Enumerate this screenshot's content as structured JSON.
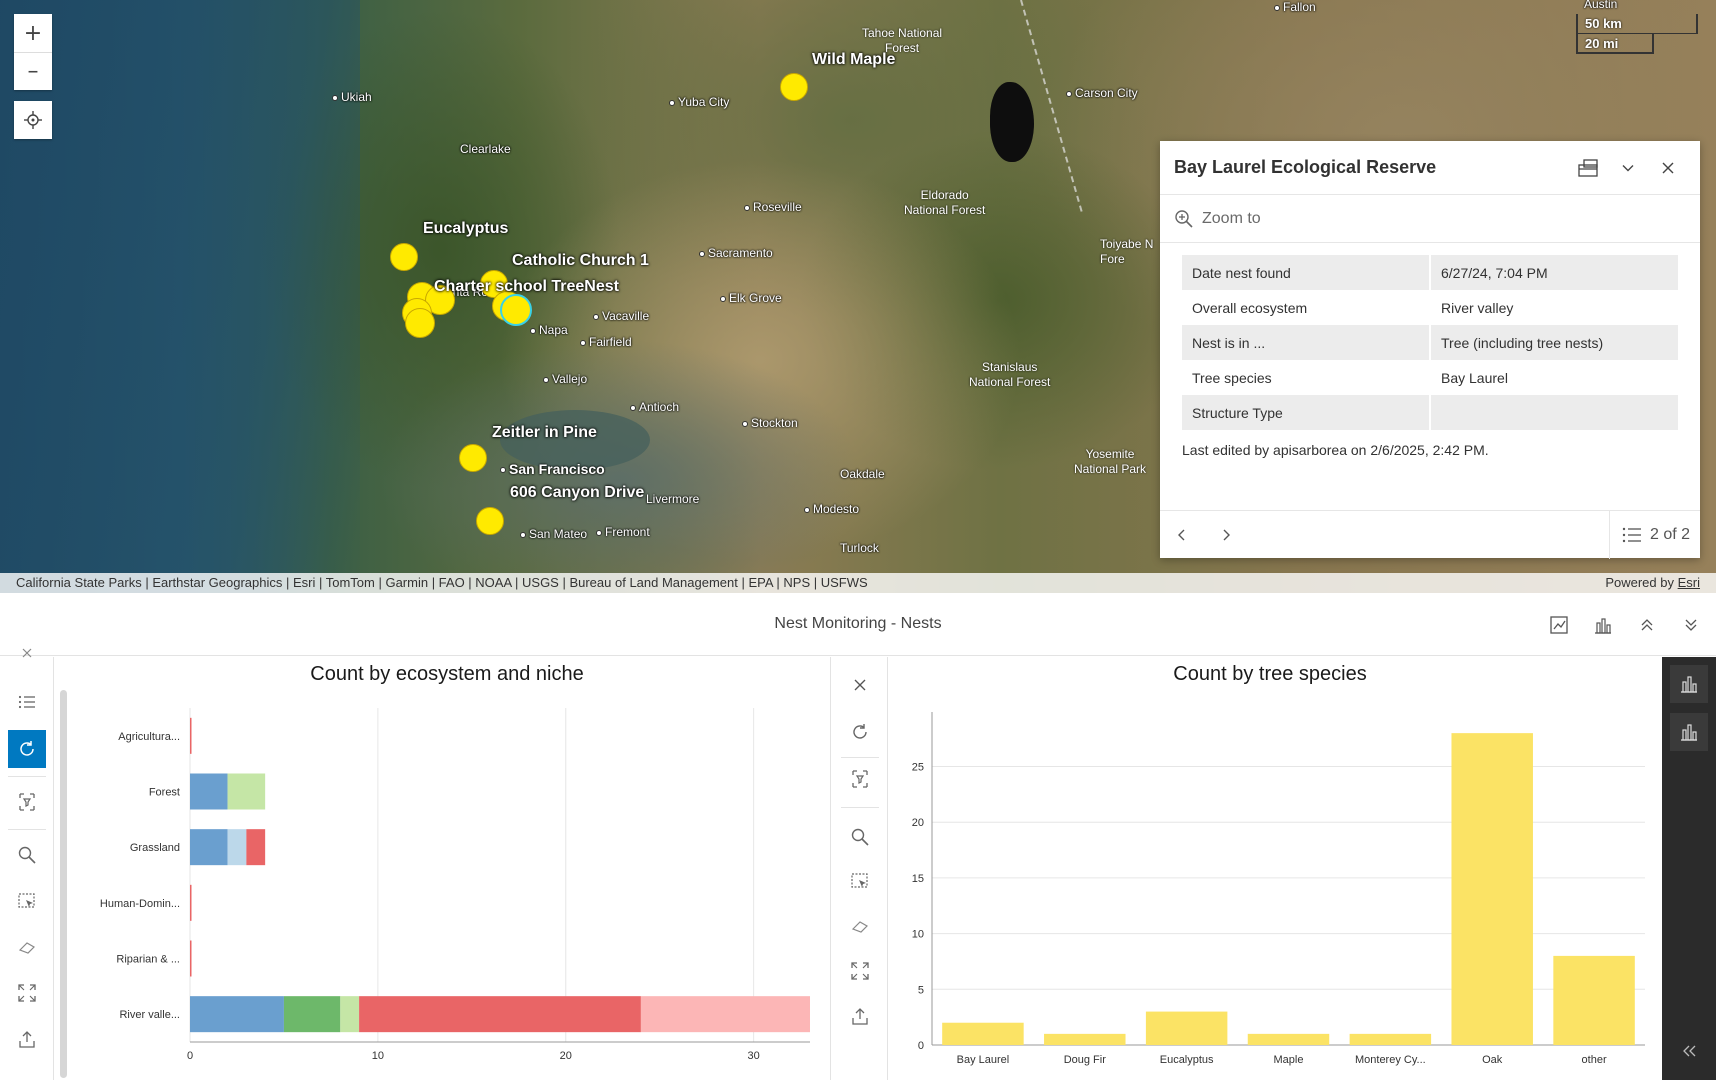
{
  "map": {
    "controls": {
      "zoom_in": "+",
      "zoom_out": "–"
    },
    "scalebar": {
      "km": "50 km",
      "mi": "20 mi"
    },
    "cities": [
      {
        "name": "Fallon"
      },
      {
        "name": "Austin"
      },
      {
        "name": "Ukiah"
      },
      {
        "name": "Yuba City"
      },
      {
        "name": "Carson City"
      },
      {
        "name": "Clearlake"
      },
      {
        "name": "Roseville"
      },
      {
        "name": "Sacramento"
      },
      {
        "name": "Santa Rosa"
      },
      {
        "name": "Elk Grove"
      },
      {
        "name": "Napa"
      },
      {
        "name": "Vacaville"
      },
      {
        "name": "Fairfield"
      },
      {
        "name": "Vallejo"
      },
      {
        "name": "Antioch"
      },
      {
        "name": "Stockton"
      },
      {
        "name": "San Francisco"
      },
      {
        "name": "Livermore"
      },
      {
        "name": "Oakdale"
      },
      {
        "name": "Modesto"
      },
      {
        "name": "San Mateo"
      },
      {
        "name": "Fremont"
      },
      {
        "name": "Turlock"
      }
    ],
    "areas": {
      "tahoe": "Tahoe National\nForest",
      "eldorado": "Eldorado\nNational Forest",
      "stanislaus": "Stanislaus\nNational Forest",
      "yosemite": "Yosemite\nNational Park",
      "toiyabe": "Toiyabe N\nFore"
    },
    "nest_labels": {
      "wild_maple": "Wild Maple",
      "eucalyptus": "Eucalyptus",
      "catholic": "Catholic Church 1",
      "charter": "Charter school TreeNest",
      "zeitler": "Zeitler in Pine",
      "canyon": "606 Canyon Drive"
    },
    "attribution": "California State Parks | Earthstar Geographics | Esri | TomTom | Garmin | FAO | NOAA | USGS | Bureau of Land Management | EPA | NPS | USFWS",
    "powered_by": "Powered by",
    "powered_by_link": "Esri"
  },
  "popup": {
    "title": "Bay Laurel Ecological Reserve",
    "zoom_to": "Zoom to",
    "fields": [
      {
        "key": "Date nest found",
        "value": "6/27/24, 7:04 PM"
      },
      {
        "key": "Overall ecosystem",
        "value": "River valley"
      },
      {
        "key": "Nest is in ...",
        "value": "Tree (including tree nests)"
      },
      {
        "key": "Tree species",
        "value": "Bay Laurel"
      },
      {
        "key": "Structure Type",
        "value": ""
      }
    ],
    "last_edited": "Last edited by apisarborea on 2/6/2025, 2:42 PM.",
    "count": "2 of 2"
  },
  "panel": {
    "title": "Nest Monitoring - Nests"
  },
  "chart_data": [
    {
      "type": "bar",
      "orientation": "horizontal",
      "stacked": true,
      "title": "Count by ecosystem and niche",
      "categories": [
        "Agricultura...",
        "Forest",
        "Grassland",
        "Human-Domin...",
        "Riparian & ...",
        "River valle..."
      ],
      "series": [
        {
          "color": "#6a9fcf",
          "values": [
            0,
            2,
            2,
            0,
            0,
            5
          ]
        },
        {
          "color": "#6db86a",
          "values": [
            0,
            0,
            0,
            0,
            0,
            3
          ]
        },
        {
          "color": "#c5e6a6",
          "values": [
            0,
            2,
            0,
            0,
            0,
            1
          ]
        },
        {
          "color": "#bcd8ea",
          "values": [
            0,
            0,
            1,
            0,
            0,
            0
          ]
        },
        {
          "color": "#e96566",
          "values": [
            0,
            0,
            1,
            0,
            0,
            15
          ]
        },
        {
          "color": "#fcb6b6",
          "values": [
            0,
            0,
            0,
            0,
            0,
            9
          ]
        }
      ],
      "xlim": [
        0,
        33
      ],
      "xticks": [
        0,
        10,
        20,
        30
      ],
      "grid": true
    },
    {
      "type": "bar",
      "title": "Count by tree species",
      "categories": [
        "Bay Laurel",
        "Doug Fir",
        "Eucalyptus",
        "Maple",
        "Monterey Cy...",
        "Oak",
        "other"
      ],
      "values": [
        2,
        1,
        3,
        1,
        1,
        28,
        8
      ],
      "color": "#fbe365",
      "ylim": [
        0,
        29
      ],
      "yticks": [
        0,
        5,
        10,
        15,
        20,
        25
      ],
      "grid": true
    }
  ]
}
